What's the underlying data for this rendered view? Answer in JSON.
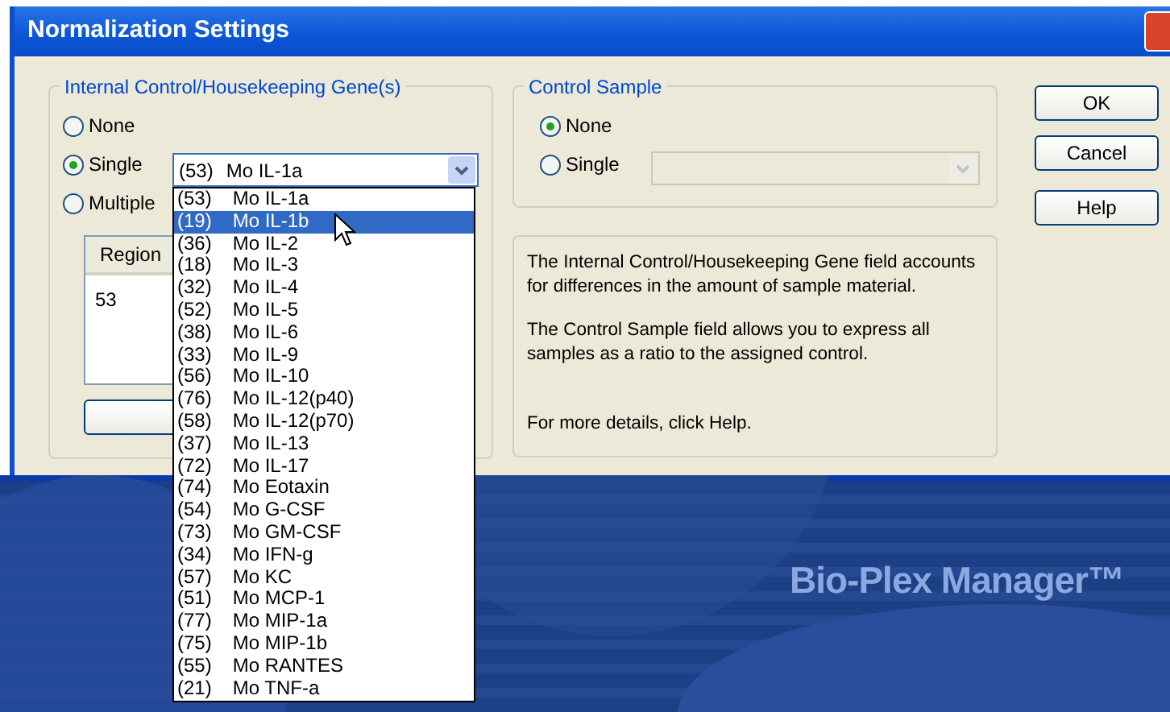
{
  "window": {
    "title": "Normalization Settings"
  },
  "internal_control": {
    "title": "Internal Control/Housekeeping Gene(s)",
    "options": [
      {
        "label": "None",
        "selected": false
      },
      {
        "label": "Single",
        "selected": true
      },
      {
        "label": "Multiple",
        "selected": false
      }
    ],
    "gene_select": {
      "region": "(53)",
      "name": "Mo IL-1a",
      "expanded": true
    },
    "region_list": {
      "column": "Region",
      "rows": [
        "53"
      ]
    },
    "dropdown_items": [
      {
        "region": "(53)",
        "name": "Mo IL-1a",
        "selected": false
      },
      {
        "region": "(19)",
        "name": "Mo IL-1b",
        "selected": true
      },
      {
        "region": "(36)",
        "name": "Mo IL-2",
        "selected": false
      },
      {
        "region": "(18)",
        "name": "Mo IL-3",
        "selected": false
      },
      {
        "region": "(32)",
        "name": "Mo IL-4",
        "selected": false
      },
      {
        "region": "(52)",
        "name": "Mo IL-5",
        "selected": false
      },
      {
        "region": "(38)",
        "name": "Mo IL-6",
        "selected": false
      },
      {
        "region": "(33)",
        "name": "Mo IL-9",
        "selected": false
      },
      {
        "region": "(56)",
        "name": "Mo IL-10",
        "selected": false
      },
      {
        "region": "(76)",
        "name": "Mo IL-12(p40)",
        "selected": false
      },
      {
        "region": "(58)",
        "name": "Mo IL-12(p70)",
        "selected": false
      },
      {
        "region": "(37)",
        "name": "Mo IL-13",
        "selected": false
      },
      {
        "region": "(72)",
        "name": "Mo IL-17",
        "selected": false
      },
      {
        "region": "(74)",
        "name": "Mo Eotaxin",
        "selected": false
      },
      {
        "region": "(54)",
        "name": "Mo G-CSF",
        "selected": false
      },
      {
        "region": "(73)",
        "name": "Mo GM-CSF",
        "selected": false
      },
      {
        "region": "(34)",
        "name": "Mo IFN-g",
        "selected": false
      },
      {
        "region": "(57)",
        "name": "Mo KC",
        "selected": false
      },
      {
        "region": "(51)",
        "name": "Mo MCP-1",
        "selected": false
      },
      {
        "region": "(77)",
        "name": "Mo MIP-1a",
        "selected": false
      },
      {
        "region": "(75)",
        "name": "Mo MIP-1b",
        "selected": false
      },
      {
        "region": "(55)",
        "name": "Mo RANTES",
        "selected": false
      },
      {
        "region": "(21)",
        "name": "Mo TNF-a",
        "selected": false
      }
    ]
  },
  "control_sample": {
    "title": "Control Sample",
    "options": [
      {
        "label": "None",
        "selected": true
      },
      {
        "label": "Single",
        "selected": false
      }
    ],
    "sample_select": {
      "disabled": true
    }
  },
  "info": [
    "The Internal Control/Housekeeping Gene field accounts for differences in the amount of sample material.",
    "The Control Sample field allows you to express all samples as a ratio to the assigned control.",
    "For more details, click Help."
  ],
  "buttons": [
    "OK",
    "Cancel",
    "Help"
  ],
  "backdrop": {
    "title": "Bio-Plex Manager™"
  }
}
